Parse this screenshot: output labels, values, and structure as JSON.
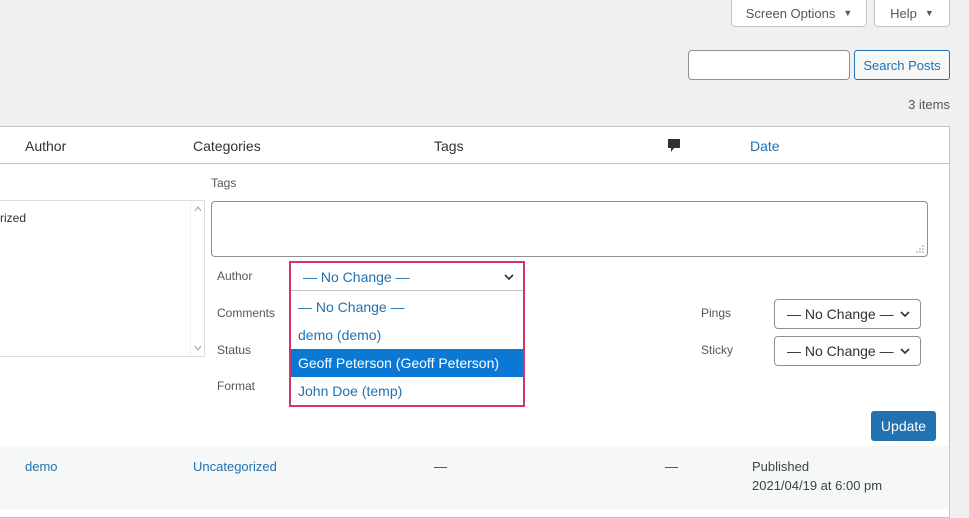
{
  "header": {
    "screen_options": "Screen Options",
    "help": "Help",
    "search_placeholder": "",
    "search_button": "Search Posts",
    "items_count": "3 items"
  },
  "table": {
    "columns": {
      "author": "Author",
      "categories": "Categories",
      "tags": "Tags",
      "date": "Date"
    },
    "comments_icon": "comment-bubble-icon"
  },
  "quick_edit": {
    "category_partial": "rized",
    "tags_label": "Tags",
    "author_label": "Author",
    "comments_label": "Comments",
    "status_label": "Status",
    "format_label": "Format",
    "pings_label": "Pings",
    "sticky_label": "Sticky",
    "author_select_value": "— No Change —",
    "author_options": [
      "— No Change —",
      "demo (demo)",
      "Geoff Peterson (Geoff Peterson)",
      "John Doe (temp)"
    ],
    "author_selected_index": 2,
    "pings_value": "— No Change —",
    "sticky_value": "— No Change —",
    "update_button": "Update"
  },
  "row": {
    "author": "demo",
    "categories": "Uncategorized",
    "tags": "—",
    "comments": "—",
    "status": "Published",
    "date": "2021/04/19 at 6:00 pm"
  },
  "colors": {
    "accent": "#2271b1",
    "dropdown_border": "#d63468",
    "selected_option": "#0b78d4"
  }
}
